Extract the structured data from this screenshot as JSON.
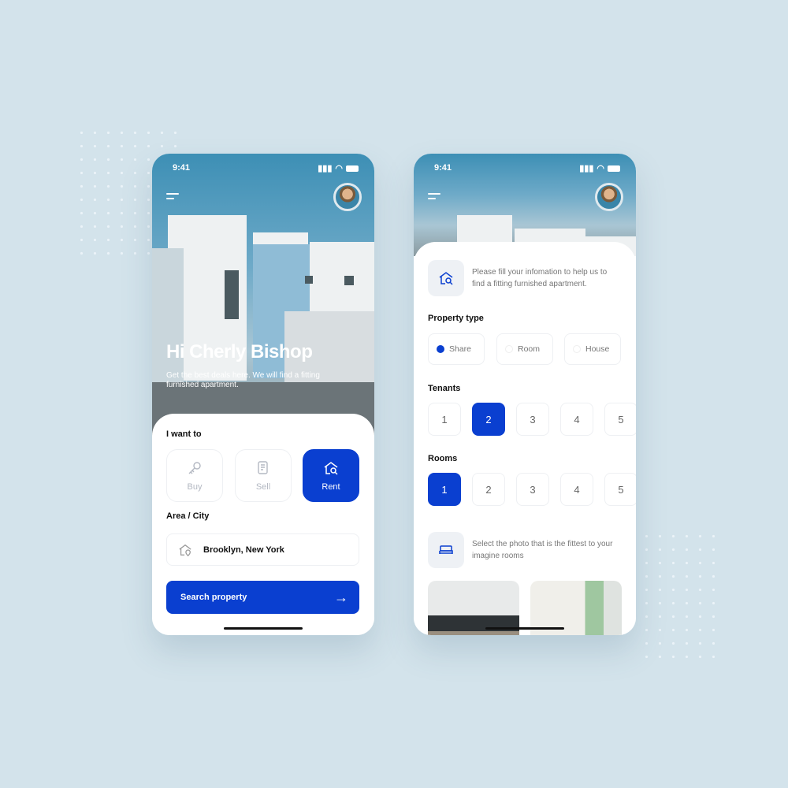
{
  "colors": {
    "accent": "#0a3fd0",
    "background": "#d3e3eb"
  },
  "home_screen": {
    "status_time": "9:41",
    "greeting": "Hi Cherly Bishop",
    "subtitle": "Get the best deals here. We will find a fitting furnished apartment.",
    "i_want_to_label": "I want to",
    "options": [
      {
        "label": "Buy",
        "icon": "key-icon",
        "selected": false
      },
      {
        "label": "Sell",
        "icon": "document-icon",
        "selected": false
      },
      {
        "label": "Rent",
        "icon": "house-search-icon",
        "selected": true
      }
    ],
    "area_label": "Area / City",
    "area_value": "Brooklyn, New York",
    "search_button": "Search property"
  },
  "form_screen": {
    "status_time": "9:41",
    "intro": "Please fill your infomation to help us to find a fitting furnished apartment.",
    "property_type_label": "Property type",
    "property_types": [
      {
        "label": "Share",
        "selected": true
      },
      {
        "label": "Room",
        "selected": false
      },
      {
        "label": "House",
        "selected": false
      }
    ],
    "tenants_label": "Tenants",
    "tenants": [
      "1",
      "2",
      "3",
      "4",
      "5"
    ],
    "tenants_selected": "2",
    "rooms_label": "Rooms",
    "rooms": [
      "1",
      "2",
      "3",
      "4",
      "5"
    ],
    "rooms_selected": "1",
    "photo_prompt": "Select the photo that is the fittest to your imagine rooms"
  }
}
